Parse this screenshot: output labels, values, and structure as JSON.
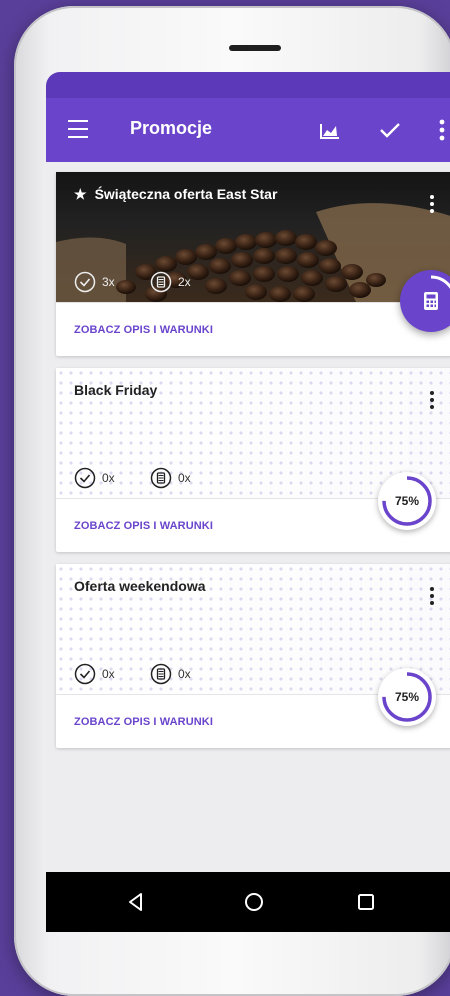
{
  "appbar": {
    "title": "Promocje",
    "icons": [
      "menu-icon",
      "chart-icon",
      "check-icon",
      "more-vert-icon"
    ]
  },
  "colors": {
    "background": "#5a3f9a",
    "appbar": "#6a45cc",
    "statusbar": "#5b39b8",
    "accent": "#6a45cc"
  },
  "promotions": [
    {
      "title": "Świąteczna oferta East Star",
      "starred": true,
      "confirmed_count": "3x",
      "calc_count": "2x",
      "link": "ZOBACZ OPIS I WARUNKI"
    },
    {
      "title": "Black Friday",
      "confirmed_count": "0x",
      "calc_count": "0x",
      "progress": "75%",
      "progress_value": 0.75,
      "link": "ZOBACZ OPIS I WARUNKI"
    },
    {
      "title": "Oferta weekendowa",
      "confirmed_count": "0x",
      "calc_count": "0x",
      "progress": "75%",
      "progress_value": 0.75,
      "link": "ZOBACZ OPIS I WARUNKI"
    }
  ],
  "fab": {
    "icon": "calculator-icon",
    "progress_value": 0.25
  },
  "navbar": {
    "icons": [
      "back-icon",
      "home-icon",
      "recent-apps-icon"
    ]
  }
}
